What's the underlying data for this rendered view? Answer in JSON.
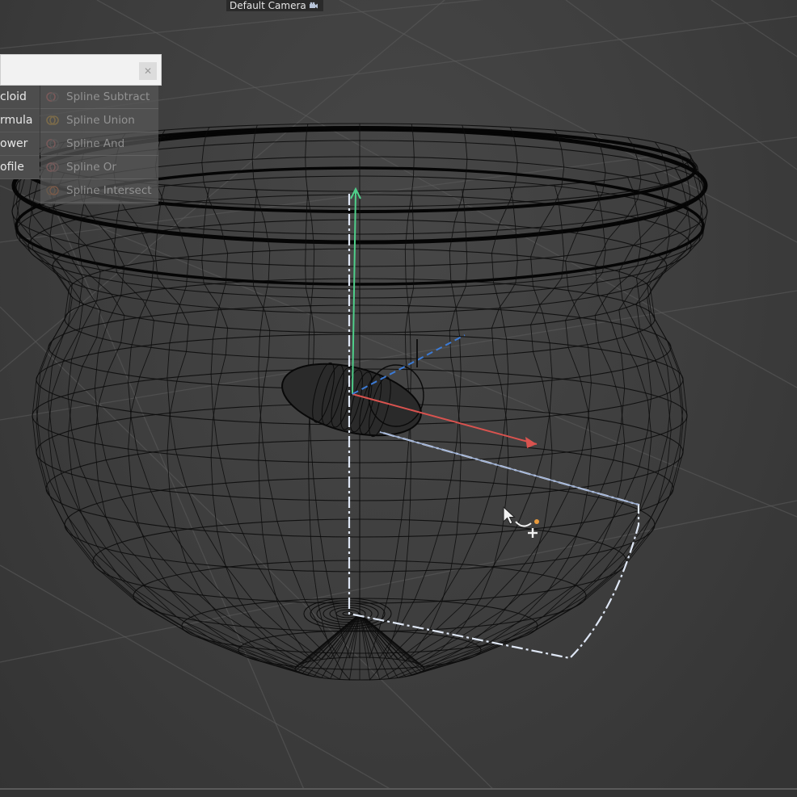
{
  "viewport": {
    "camera_label": "Default Camera",
    "camera_icon": "camera-icon"
  },
  "popup": {
    "search_value": "",
    "close_icon": "close-icon",
    "left_items": [
      {
        "label": "cloid"
      },
      {
        "label": "rmula"
      },
      {
        "label": "ower"
      },
      {
        "label": "ofile"
      }
    ],
    "right_items": [
      {
        "label": "Spline Subtract",
        "icon": "spline-subtract-icon"
      },
      {
        "label": "Spline Union",
        "icon": "spline-union-icon"
      },
      {
        "label": "Spline And",
        "icon": "spline-and-icon"
      },
      {
        "label": "Spline Or",
        "icon": "spline-or-icon"
      },
      {
        "label": "Spline Intersect",
        "icon": "spline-intersect-icon"
      }
    ]
  },
  "cursor": {
    "icon": "pen-add-point-cursor-icon"
  },
  "colors": {
    "axis_y": "#4fcf8a",
    "axis_x": "#d9534f",
    "axis_z": "#3c7bd6",
    "spline": "#dfe7f5",
    "wire": "#0c0c0c"
  }
}
